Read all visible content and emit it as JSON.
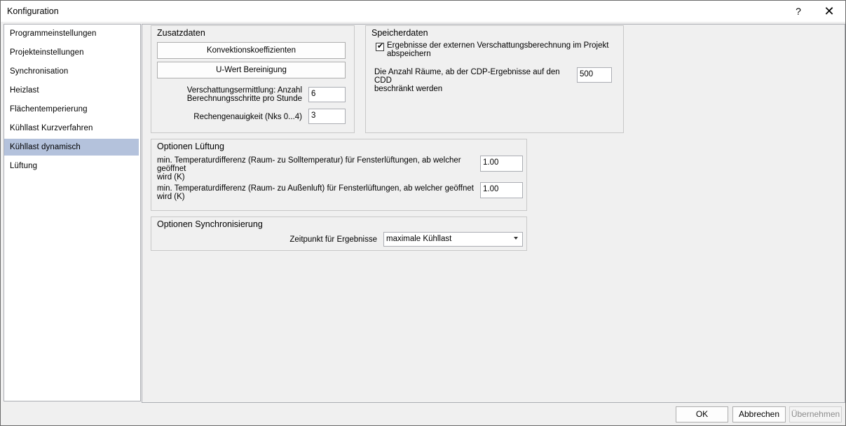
{
  "window": {
    "title": "Konfiguration",
    "help_label": "?",
    "close_label": "✕"
  },
  "sidebar": {
    "items": [
      {
        "label": "Programmeinstellungen"
      },
      {
        "label": "Projekteinstellungen"
      },
      {
        "label": "Synchronisation"
      },
      {
        "label": "Heizlast"
      },
      {
        "label": "Flächentemperierung"
      },
      {
        "label": "Kühllast Kurzverfahren"
      },
      {
        "label": "Kühllast dynamisch",
        "selected": true
      },
      {
        "label": "Lüftung"
      }
    ]
  },
  "zusatzdaten": {
    "title": "Zusatzdaten",
    "btn_konvektion": "Konvektionskoeffizienten",
    "btn_uwert": "U-Wert Bereinigung",
    "verschattung_label_1": "Verschattungsermittlung: Anzahl",
    "verschattung_label_2": "Berechnungsschritte pro Stunde",
    "verschattung_value": "6",
    "genauigkeit_label": "Rechengenauigkeit (Nks 0...4)",
    "genauigkeit_value": "3"
  },
  "speicherdaten": {
    "title": "Speicherdaten",
    "checkbox_checked": true,
    "checkbox_label_1": "Ergebnisse der externen Verschattungsberechnung im Projekt",
    "checkbox_label_2": "abspeichern",
    "anzahl_label_1": "Die Anzahl Räume, ab der CDP-Ergebnisse auf den CDD",
    "anzahl_label_2": "beschränkt werden",
    "anzahl_value": "500"
  },
  "lueftung": {
    "title": "Optionen Lüftung",
    "soll_label_1": "min. Temperaturdifferenz (Raum- zu Solltemperatur) für Fensterlüftungen, ab welcher geöffnet",
    "soll_label_2": "wird (K)",
    "soll_value": "1.00",
    "aussen_label": "min. Temperaturdifferenz (Raum- zu Außenluft) für Fensterlüftungen, ab welcher geöffnet wird (K)",
    "aussen_value": "1.00"
  },
  "sync": {
    "title": "Optionen Synchronisierung",
    "zeitpunkt_label": "Zeitpunkt für Ergebnisse",
    "zeitpunkt_value": "maximale Kühllast"
  },
  "footer": {
    "ok": "OK",
    "cancel": "Abbrechen",
    "apply": "Übernehmen"
  }
}
